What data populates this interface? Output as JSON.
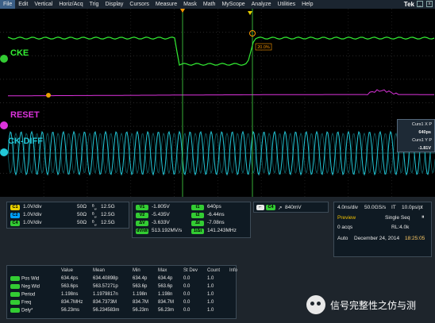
{
  "menu": {
    "items": [
      "File",
      "Edit",
      "Vertical",
      "Horiz/Acq",
      "Trig",
      "Display",
      "Cursors",
      "Measure",
      "Mask",
      "Math",
      "MyScope",
      "Analyze",
      "Utilities",
      "Help"
    ],
    "brand": "Tek",
    "window_buttons": [
      "_",
      "x"
    ]
  },
  "channels": {
    "cke": {
      "label": "CKE",
      "color": "#33ee33"
    },
    "reset": {
      "label": "RESET",
      "color": "#dd33dd"
    },
    "ckdiff": {
      "label": "CK-DIFF",
      "color": "#22c8d8"
    }
  },
  "cursor_box": {
    "x_label": "Curs1 X P",
    "x_value": "640ps",
    "y_label": "Curs1 Y P",
    "y_value": "-1.81V"
  },
  "markers": {
    "pct_tag": "20.0%"
  },
  "channel_settings": [
    {
      "id": "C1",
      "color": "#e8d000",
      "scale": "1.0V/div",
      "imp": "50Ω",
      "bw": "12.5G"
    },
    {
      "id": "C2",
      "color": "#00a0ff",
      "scale": "1.0V/div",
      "imp": "50Ω",
      "bw": "12.5G"
    },
    {
      "id": "C4",
      "color": "#33cc33",
      "scale": "1.0V/div",
      "imp": "50Ω",
      "bw": "12.5G"
    }
  ],
  "cursor_values": {
    "left": [
      {
        "tag": "V1",
        "value": "-1.805V"
      },
      {
        "tag": "V2",
        "value": "-5.435V"
      },
      {
        "tag": "ΔV",
        "value": "-3.633V"
      },
      {
        "tag": "dV/dt",
        "value": "513.192MV/s"
      }
    ],
    "right": [
      {
        "tag": "t1",
        "value": "640ps"
      },
      {
        "tag": "t2",
        "value": "-6.44ns"
      },
      {
        "tag": "Δt",
        "value": "-7.08ns"
      },
      {
        "tag": "1/Δt",
        "value": "141.243MHz"
      }
    ]
  },
  "trigger": {
    "ch": "C4",
    "icon": "edge",
    "level": "840mV"
  },
  "acquisition": {
    "timebase": "4.0ns/div",
    "rate": "50.0GS/s",
    "it": "IT",
    "resolution": "10.0ps/pt",
    "mode_label": "Preview",
    "mode_value": "Single Seq",
    "acqs": "0 acqs",
    "record": "RL:4.0k",
    "trig_mode": "Auto",
    "date": "December 24, 2014",
    "time": "18:25:05"
  },
  "measurements": {
    "headers": [
      "",
      "Value",
      "Mean",
      "Min",
      "Max",
      "St Dev",
      "Count",
      "Info"
    ],
    "rows": [
      {
        "ch": "C4",
        "color": "#33cc33",
        "name": "Pos Wid",
        "value": "634.4ps",
        "mean": "634.40898p",
        "min": "634.4p",
        "max": "634.4p",
        "stdev": "0.0",
        "count": "1.0"
      },
      {
        "ch": "C4",
        "color": "#33cc33",
        "name": "Neg Wid",
        "value": "563.6ps",
        "mean": "563.57271p",
        "min": "563.6p",
        "max": "563.6p",
        "stdev": "0.0",
        "count": "1.0"
      },
      {
        "ch": "C4",
        "color": "#33cc33",
        "name": "Period",
        "value": "1.198ns",
        "mean": "1.1979817n",
        "min": "1.198n",
        "max": "1.198n",
        "stdev": "0.0",
        "count": "1.0"
      },
      {
        "ch": "C4",
        "color": "#33cc33",
        "name": "Freq",
        "value": "834.7MHz",
        "mean": "834.7373M",
        "min": "834.7M",
        "max": "834.7M",
        "stdev": "0.0",
        "count": "1.0"
      },
      {
        "ch": "C4",
        "color": "#33cc33",
        "name": "Dely*",
        "value": "56.23ms",
        "mean": "56.234583m",
        "min": "56.23m",
        "max": "56.23m",
        "stdev": "0.0",
        "count": "1.0"
      }
    ]
  },
  "watermark": {
    "text": "信号完整性之仿与测"
  }
}
